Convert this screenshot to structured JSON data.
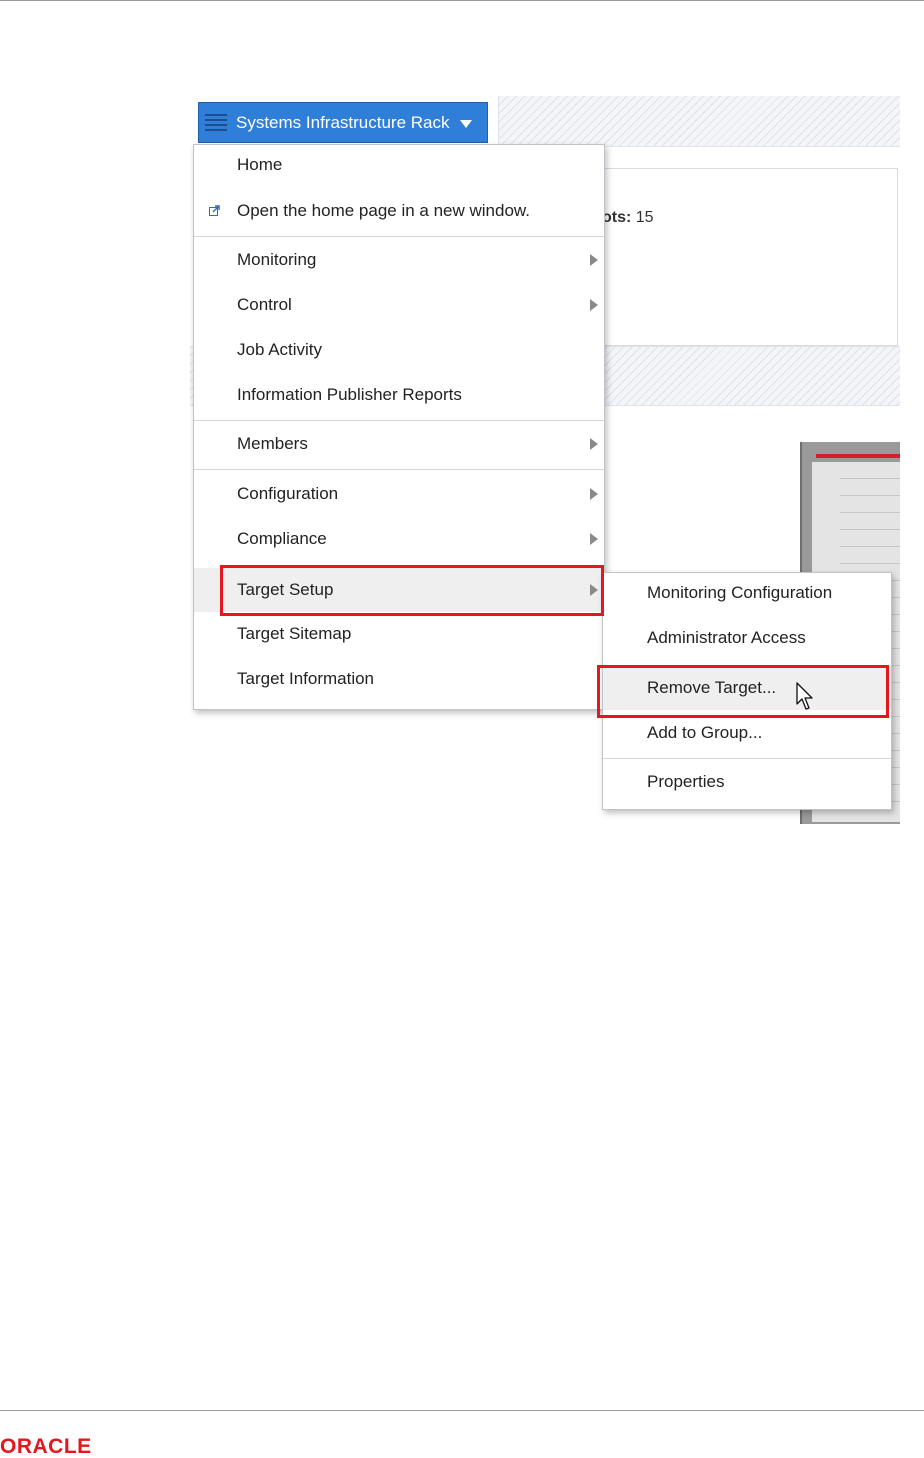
{
  "header_button": {
    "label": "Systems Infrastructure Rack"
  },
  "info": {
    "label": "ots:",
    "value": "15"
  },
  "main_menu": {
    "items": [
      {
        "label": "Home",
        "submenu": false
      },
      {
        "label": "Open the home page in a new window.",
        "submenu": false,
        "icon": "new-window-icon"
      },
      {
        "label": "Monitoring",
        "submenu": true
      },
      {
        "label": "Control",
        "submenu": true
      },
      {
        "label": "Job Activity",
        "submenu": false
      },
      {
        "label": "Information Publisher Reports",
        "submenu": false
      },
      {
        "label": "Members",
        "submenu": true
      },
      {
        "label": "Configuration",
        "submenu": true
      },
      {
        "label": "Compliance",
        "submenu": true
      },
      {
        "label": "Target Setup",
        "submenu": true,
        "highlighted": true
      },
      {
        "label": "Target Sitemap",
        "submenu": false
      },
      {
        "label": "Target Information",
        "submenu": false
      }
    ]
  },
  "sub_menu": {
    "items": [
      {
        "label": "Monitoring Configuration"
      },
      {
        "label": "Administrator Access"
      },
      {
        "label": "Remove Target...",
        "highlighted": true
      },
      {
        "label": "Add to Group..."
      },
      {
        "label": "Properties"
      }
    ]
  },
  "footer": {
    "logo_text": "ORACLE"
  },
  "colors": {
    "button_blue": "#2f7ed8",
    "highlight_red": "#e4161e",
    "logo_red": "#e4161e",
    "menu_hover": "#efefef"
  }
}
